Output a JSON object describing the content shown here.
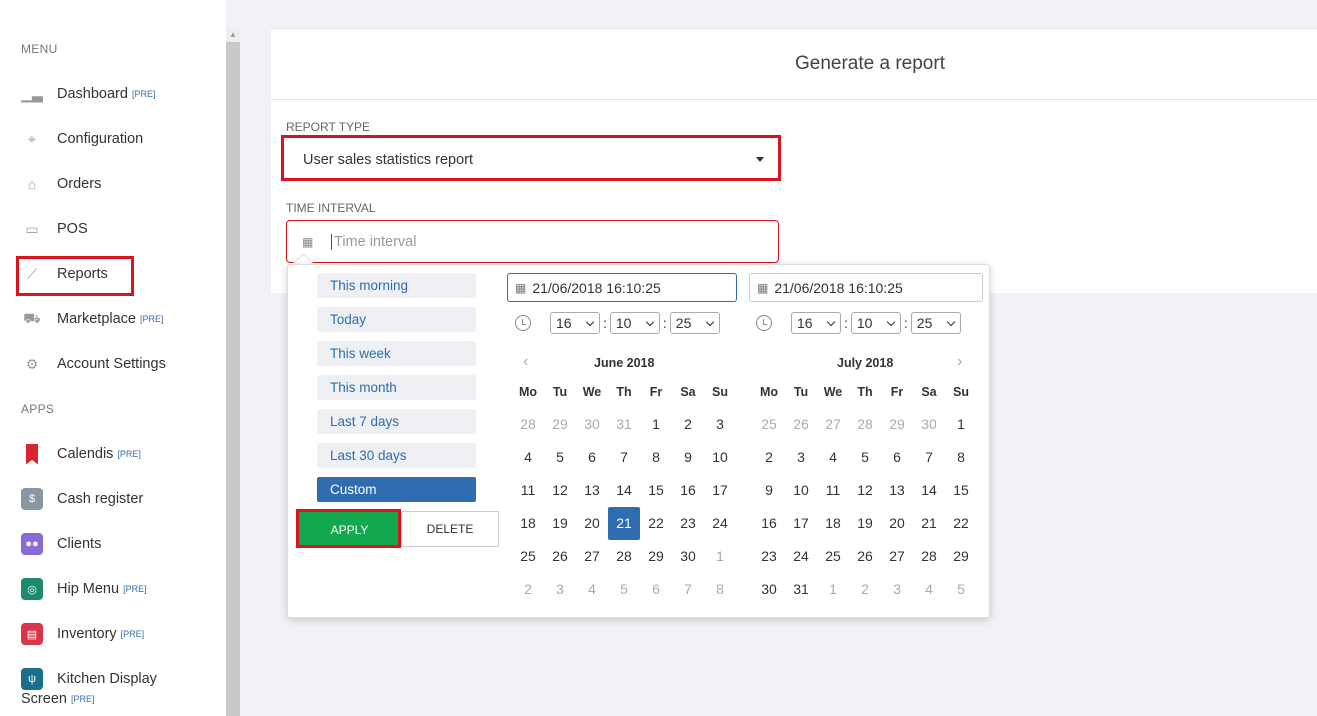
{
  "sidebar": {
    "menu_title": "MENU",
    "apps_title": "APPS",
    "pre_tag": "[PRE]",
    "menu_items": [
      {
        "label": "Dashboard",
        "pre": true,
        "icon": "bar-chart-icon"
      },
      {
        "label": "Configuration",
        "pre": false,
        "icon": "tag-icon"
      },
      {
        "label": "Orders",
        "pre": false,
        "icon": "shopping-bag-icon"
      },
      {
        "label": "POS",
        "pre": false,
        "icon": "monitor-icon"
      },
      {
        "label": "Reports",
        "pre": false,
        "icon": "line-chart-icon"
      },
      {
        "label": "Marketplace",
        "pre": true,
        "icon": "cart-icon"
      },
      {
        "label": "Account Settings",
        "pre": false,
        "icon": "gear-icon"
      }
    ],
    "app_items": [
      {
        "label": "Calendis",
        "pre": true,
        "icon": "bookmark-icon",
        "color": "#d9252b"
      },
      {
        "label": "Cash register",
        "pre": false,
        "icon": "cash-register-icon",
        "color": "#8a96a3"
      },
      {
        "label": "Clients",
        "pre": false,
        "icon": "users-icon",
        "color": "#8a6bd6"
      },
      {
        "label": "Hip Menu",
        "pre": true,
        "icon": "hip-menu-icon",
        "color": "#1c8a6e"
      },
      {
        "label": "Inventory",
        "pre": true,
        "icon": "inventory-icon",
        "color": "#d9364a"
      },
      {
        "label": "Kitchen Display",
        "label2": "Screen",
        "pre": true,
        "icon": "cutlery-icon",
        "color": "#1a6f8a"
      }
    ]
  },
  "main": {
    "title": "Generate a report",
    "report_type_label": "REPORT TYPE",
    "report_type_value": "User sales statistics report",
    "time_interval_label": "TIME INTERVAL",
    "time_interval_placeholder": "Time interval"
  },
  "picker": {
    "ranges": [
      "This morning",
      "Today",
      "This week",
      "This month",
      "Last 7 days",
      "Last 30 days",
      "Custom"
    ],
    "active_range": "Custom",
    "apply_label": "APPLY",
    "delete_label": "DELETE",
    "start_datetime": "21/06/2018 16:10:25",
    "end_datetime": "21/06/2018 16:10:25",
    "start_time": {
      "h": "16",
      "m": "10",
      "s": "25"
    },
    "end_time": {
      "h": "16",
      "m": "10",
      "s": "25"
    },
    "weekdays": [
      "Mo",
      "Tu",
      "We",
      "Th",
      "Fr",
      "Sa",
      "Su"
    ],
    "left_month": {
      "title": "June 2018",
      "weeks": [
        [
          "28",
          "29",
          "30",
          "31",
          "1",
          "2",
          "3"
        ],
        [
          "4",
          "5",
          "6",
          "7",
          "8",
          "9",
          "10"
        ],
        [
          "11",
          "12",
          "13",
          "14",
          "15",
          "16",
          "17"
        ],
        [
          "18",
          "19",
          "20",
          "21",
          "22",
          "23",
          "24"
        ],
        [
          "25",
          "26",
          "27",
          "28",
          "29",
          "30",
          "1"
        ],
        [
          "2",
          "3",
          "4",
          "5",
          "6",
          "7",
          "8"
        ]
      ],
      "muted": [
        [
          0,
          0
        ],
        [
          0,
          1
        ],
        [
          0,
          2
        ],
        [
          0,
          3
        ],
        [
          4,
          6
        ],
        [
          5,
          0
        ],
        [
          5,
          1
        ],
        [
          5,
          2
        ],
        [
          5,
          3
        ],
        [
          5,
          4
        ],
        [
          5,
          5
        ],
        [
          5,
          6
        ]
      ],
      "selected": [
        3,
        3
      ]
    },
    "right_month": {
      "title": "July 2018",
      "weeks": [
        [
          "25",
          "26",
          "27",
          "28",
          "29",
          "30",
          "1"
        ],
        [
          "2",
          "3",
          "4",
          "5",
          "6",
          "7",
          "8"
        ],
        [
          "9",
          "10",
          "11",
          "12",
          "13",
          "14",
          "15"
        ],
        [
          "16",
          "17",
          "18",
          "19",
          "20",
          "21",
          "22"
        ],
        [
          "23",
          "24",
          "25",
          "26",
          "27",
          "28",
          "29"
        ],
        [
          "30",
          "31",
          "1",
          "2",
          "3",
          "4",
          "5"
        ]
      ],
      "muted": [
        [
          0,
          0
        ],
        [
          0,
          1
        ],
        [
          0,
          2
        ],
        [
          0,
          3
        ],
        [
          0,
          4
        ],
        [
          0,
          5
        ],
        [
          5,
          2
        ],
        [
          5,
          3
        ],
        [
          5,
          4
        ],
        [
          5,
          5
        ],
        [
          5,
          6
        ]
      ],
      "selected": null
    }
  }
}
